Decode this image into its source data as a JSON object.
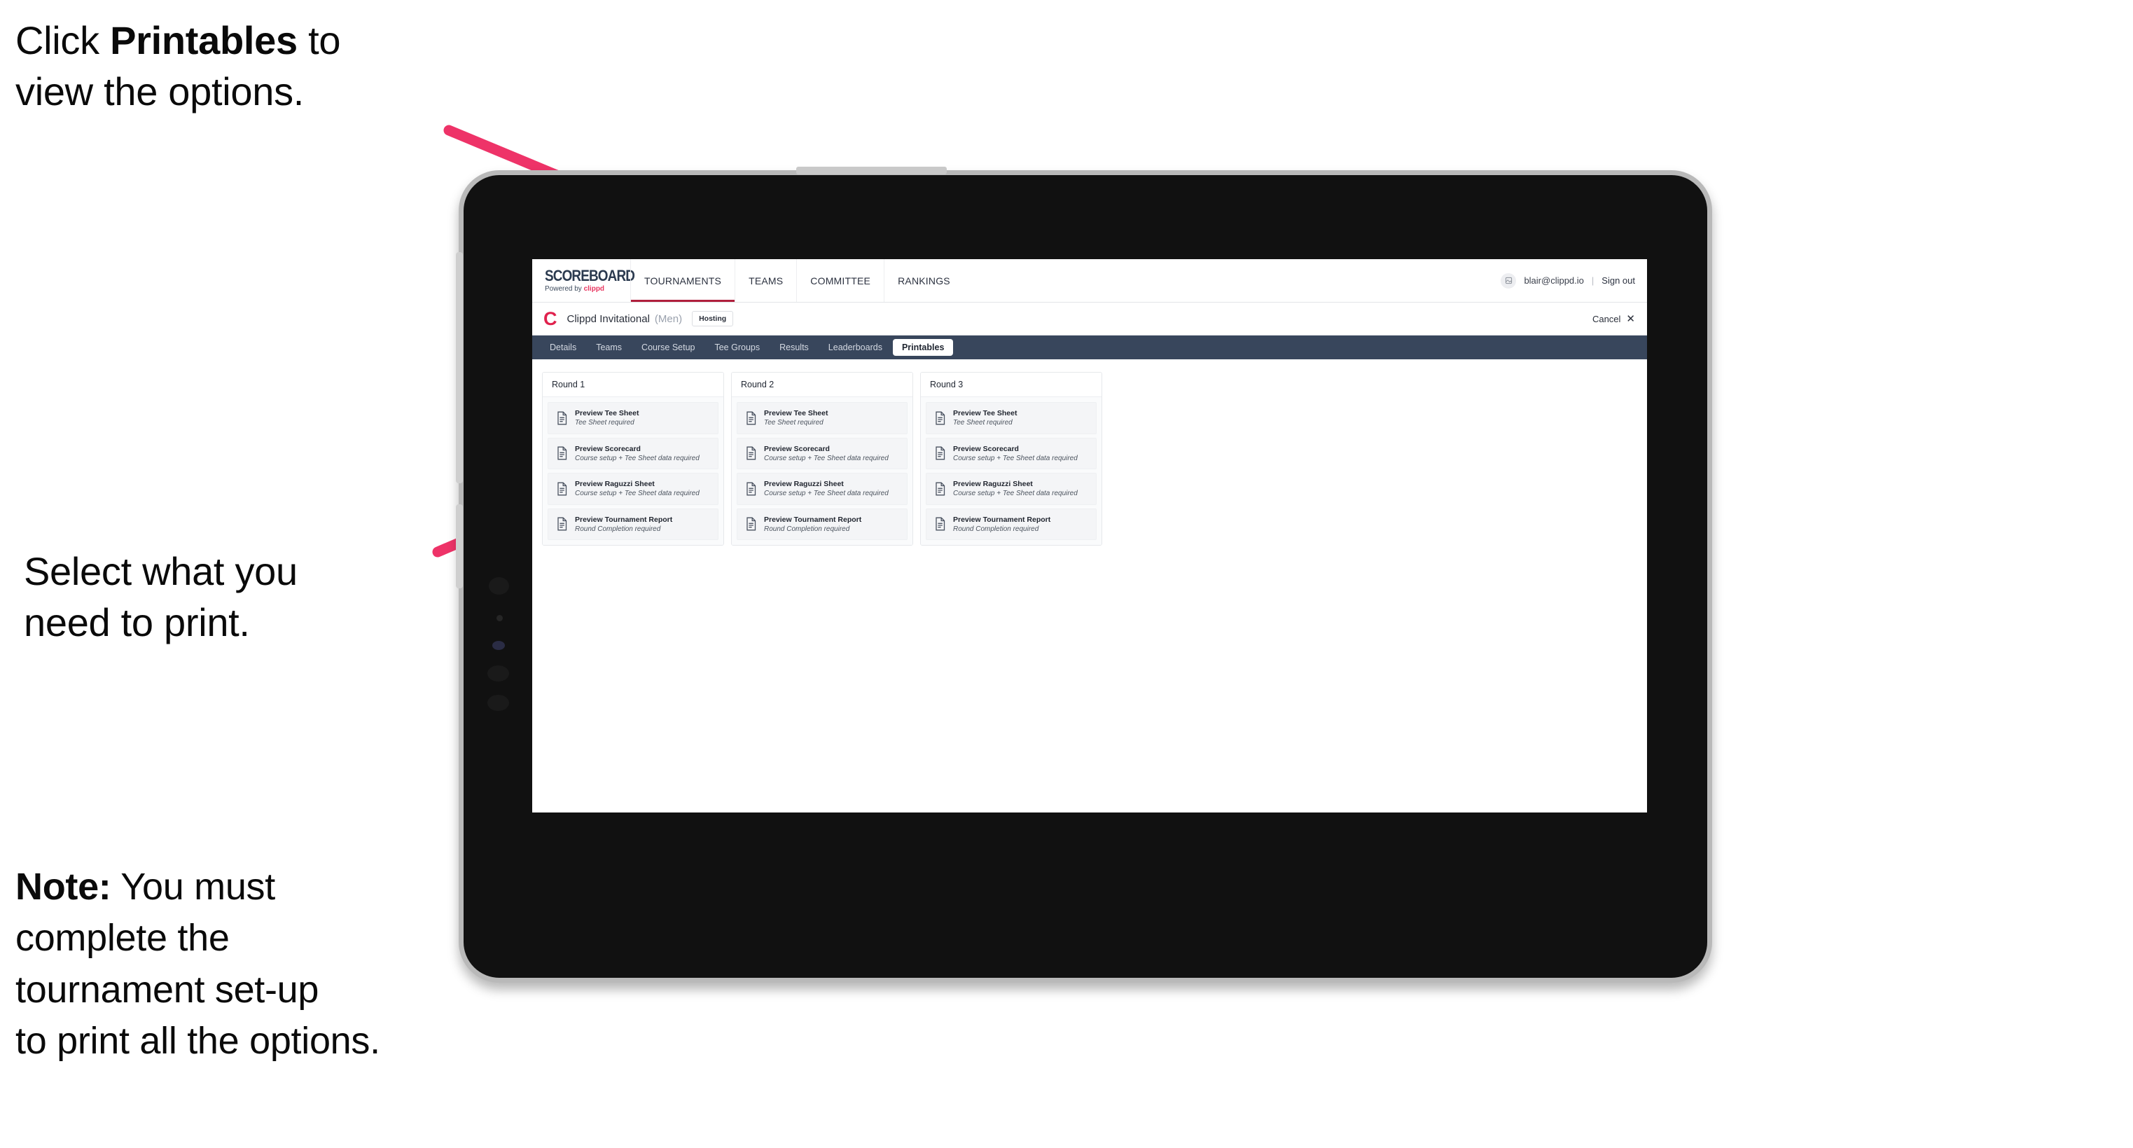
{
  "annotations": {
    "step1": "Click Printables to\nview the options.",
    "step1_plain_a": "Click ",
    "step1_bold": "Printables",
    "step1_plain_b": " to\nview the options.",
    "step2": "Select what you\n need to print.",
    "note_label": "Note:",
    "note_body": " You must\ncomplete the\ntournament set-up\nto print all the options.",
    "arrow_color": "#ee3368"
  },
  "device": {
    "type": "tablet",
    "bezel_color": "#111111",
    "frame_color": "#b9b9b9"
  },
  "app": {
    "header": {
      "logo_title": "SCOREBOARD",
      "logo_tagline_prefix": "Powered by ",
      "logo_tagline_brand": "clippd",
      "nav": [
        {
          "label": "TOURNAMENTS",
          "active": true
        },
        {
          "label": "TEAMS",
          "active": false
        },
        {
          "label": "COMMITTEE",
          "active": false
        },
        {
          "label": "RANKINGS",
          "active": false
        }
      ],
      "avatar_icon": "user-avatar-icon",
      "user_email": "blair@clippd.io",
      "separator": "|",
      "sign_out": "Sign out",
      "active_underline_color": "#b01f3c"
    },
    "titlebar": {
      "brand_mark": "C",
      "tournament_name": "Clippd Invitational",
      "gender": "(Men)",
      "status_badge": "Hosting",
      "cancel_label": "Cancel",
      "close_icon": "close-icon"
    },
    "subnav": {
      "background": "#38465c",
      "tabs": [
        {
          "label": "Details",
          "selected": false
        },
        {
          "label": "Teams",
          "selected": false
        },
        {
          "label": "Course Setup",
          "selected": false
        },
        {
          "label": "Tee Groups",
          "selected": false
        },
        {
          "label": "Results",
          "selected": false
        },
        {
          "label": "Leaderboards",
          "selected": false
        },
        {
          "label": "Printables",
          "selected": true
        }
      ]
    },
    "printables": {
      "rounds": [
        {
          "title": "Round 1",
          "items": [
            {
              "title": "Preview Tee Sheet",
              "requirement": "Tee Sheet required",
              "icon": "document-icon"
            },
            {
              "title": "Preview Scorecard",
              "requirement": "Course setup + Tee Sheet data required",
              "icon": "document-icon"
            },
            {
              "title": "Preview Raguzzi Sheet",
              "requirement": "Course setup + Tee Sheet data required",
              "icon": "document-icon"
            },
            {
              "title": "Preview Tournament Report",
              "requirement": "Round Completion required",
              "icon": "document-icon"
            }
          ]
        },
        {
          "title": "Round 2",
          "items": [
            {
              "title": "Preview Tee Sheet",
              "requirement": "Tee Sheet required",
              "icon": "document-icon"
            },
            {
              "title": "Preview Scorecard",
              "requirement": "Course setup + Tee Sheet data required",
              "icon": "document-icon"
            },
            {
              "title": "Preview Raguzzi Sheet",
              "requirement": "Course setup + Tee Sheet data required",
              "icon": "document-icon"
            },
            {
              "title": "Preview Tournament Report",
              "requirement": "Round Completion required",
              "icon": "document-icon"
            }
          ]
        },
        {
          "title": "Round 3",
          "items": [
            {
              "title": "Preview Tee Sheet",
              "requirement": "Tee Sheet required",
              "icon": "document-icon"
            },
            {
              "title": "Preview Scorecard",
              "requirement": "Course setup + Tee Sheet data required",
              "icon": "document-icon"
            },
            {
              "title": "Preview Raguzzi Sheet",
              "requirement": "Course setup + Tee Sheet data required",
              "icon": "document-icon"
            },
            {
              "title": "Preview Tournament Report",
              "requirement": "Round Completion required",
              "icon": "document-icon"
            }
          ]
        }
      ]
    }
  }
}
